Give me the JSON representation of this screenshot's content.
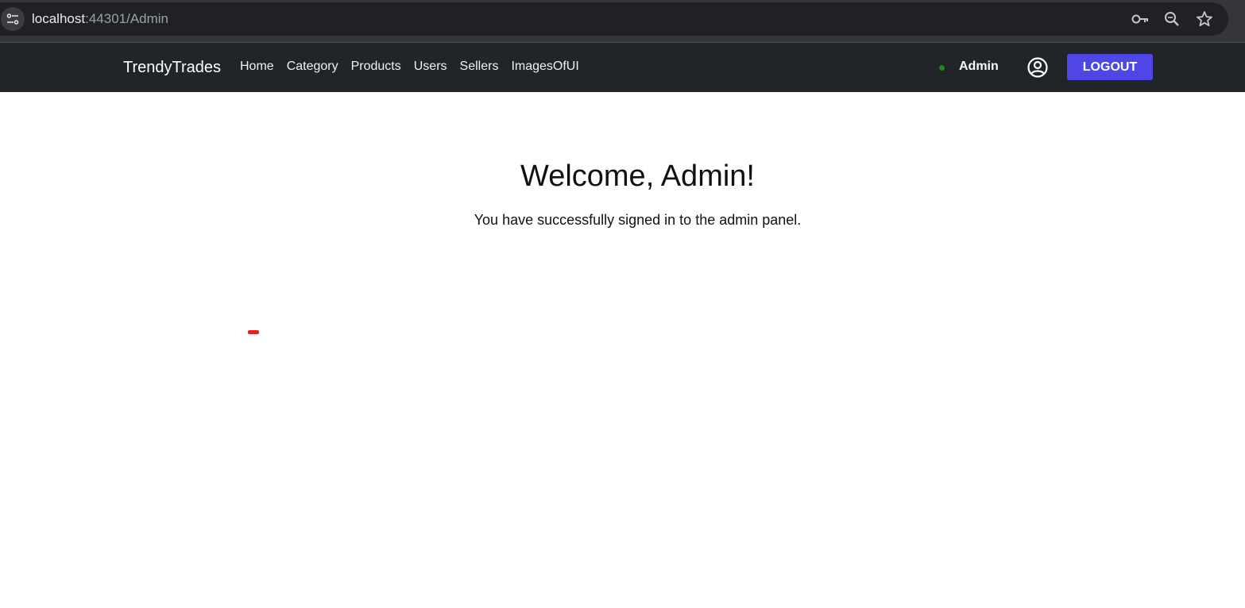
{
  "browser": {
    "url_host": "localhost",
    "url_rest": ":44301/Admin",
    "icons": [
      "site-info-icon",
      "password-key-icon",
      "zoom-icon",
      "bookmark-star-icon"
    ]
  },
  "navbar": {
    "brand": "TrendyTrades",
    "links": [
      "Home",
      "Category",
      "Products",
      "Users",
      "Sellers",
      "ImagesOfUI"
    ],
    "user_name": "Admin",
    "status_color": "#1a8a1a",
    "logout_label": "LOGOUT",
    "logout_color": "#4f46e5",
    "background": "#212529"
  },
  "main": {
    "title": "Welcome, Admin!",
    "message": "You have successfully signed in to the admin panel."
  }
}
